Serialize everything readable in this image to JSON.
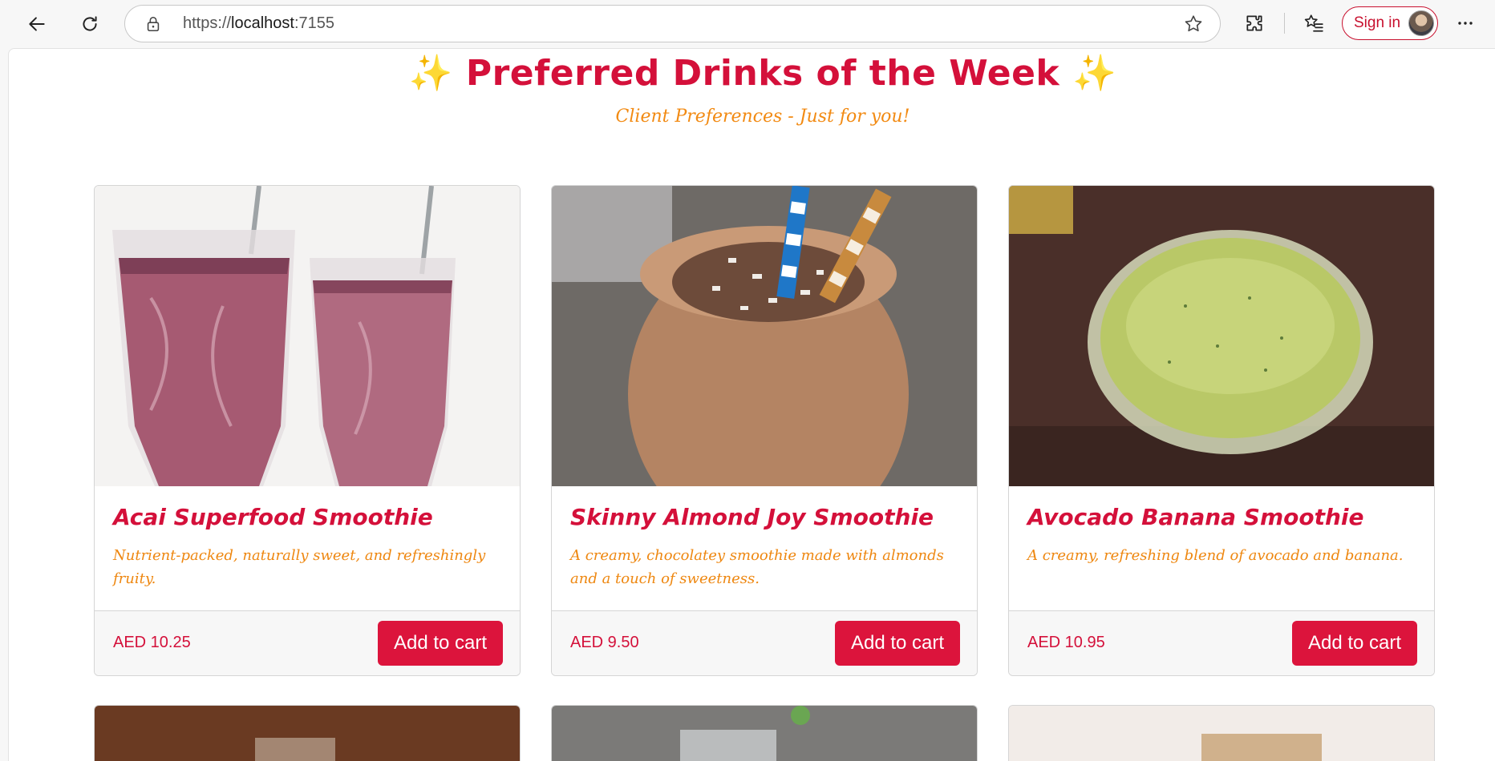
{
  "browser": {
    "url_prefix": "https://",
    "url_host": "localhost",
    "url_port": ":7155",
    "sign_in_label": "Sign in"
  },
  "hero": {
    "sparkle_left": "✨",
    "title": "Preferred Drinks of the Week",
    "sparkle_right": "✨",
    "subtitle": "Client Preferences - Just for you!"
  },
  "products": [
    {
      "name": "Acai Superfood Smoothie",
      "description": "Nutrient-packed, naturally sweet, and refreshingly fruity.",
      "price": "AED 10.25",
      "button": "Add to cart"
    },
    {
      "name": "Skinny Almond Joy Smoothie",
      "description": "A creamy, chocolatey smoothie made with almonds and a touch of sweetness.",
      "price": "AED 9.50",
      "button": "Add to cart"
    },
    {
      "name": "Avocado Banana Smoothie",
      "description": "A creamy, refreshing blend of avocado and banana.",
      "price": "AED 10.95",
      "button": "Add to cart"
    }
  ],
  "colors": {
    "brand": "#dc143c",
    "accent_text": "#f28a12",
    "browser_bg": "#f7f7f7"
  }
}
